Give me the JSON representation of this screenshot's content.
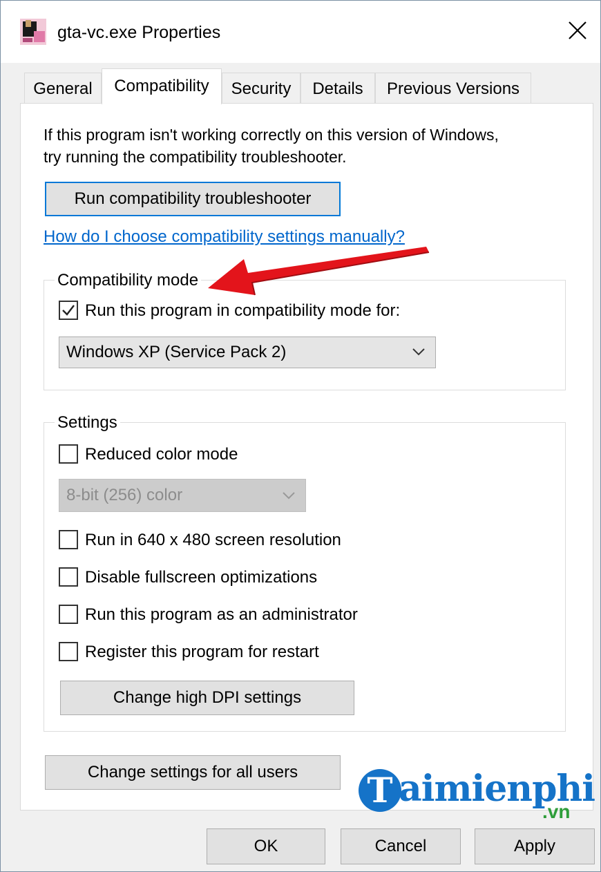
{
  "window": {
    "title": "gta-vc.exe Properties",
    "icon": "gta-app-icon",
    "close_icon": "close-icon"
  },
  "tabs": [
    {
      "label": "General",
      "active": false
    },
    {
      "label": "Compatibility",
      "active": true
    },
    {
      "label": "Security",
      "active": false
    },
    {
      "label": "Details",
      "active": false
    },
    {
      "label": "Previous Versions",
      "active": false
    }
  ],
  "compat": {
    "intro_line1": "If this program isn't working correctly on this version of Windows,",
    "intro_line2": "try running the compatibility troubleshooter.",
    "troubleshooter_button": "Run compatibility troubleshooter",
    "help_link": "How do I choose compatibility settings manually?",
    "mode_group": {
      "legend": "Compatibility mode",
      "checkbox_label": "Run this program in compatibility mode for:",
      "checked": true,
      "selected_os": "Windows XP (Service Pack 2)"
    },
    "settings_group": {
      "legend": "Settings",
      "reduced_color": {
        "label": "Reduced color mode",
        "checked": false
      },
      "color_select": "8-bit (256) color",
      "resolution": {
        "label": "Run in 640 x 480 screen resolution",
        "checked": false
      },
      "fullscreen": {
        "label": "Disable fullscreen optimizations",
        "checked": false
      },
      "admin": {
        "label": "Run this program as an administrator",
        "checked": false
      },
      "restart": {
        "label": "Register this program for restart",
        "checked": false
      },
      "dpi_button": "Change high DPI settings"
    },
    "all_users_button": "Change settings for all users"
  },
  "footer": {
    "ok": "OK",
    "cancel": "Cancel",
    "apply": "Apply"
  },
  "watermark": {
    "letter": "T",
    "text": "aimienphi",
    "suffix": ".vn"
  },
  "colors": {
    "accent": "#0078d7",
    "link": "#0066cc",
    "arrow": "#e3141b",
    "watermark_blue": "#1573c8",
    "watermark_green": "#2e9d3a"
  }
}
